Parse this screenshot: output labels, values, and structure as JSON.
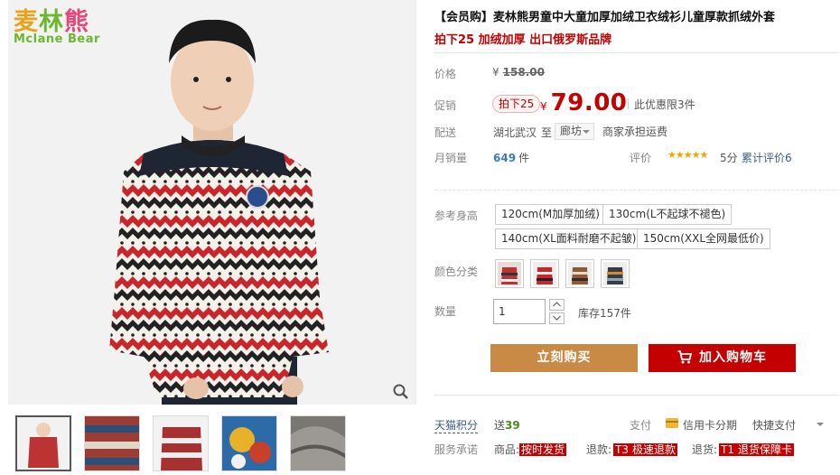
{
  "brand": {
    "name_cn": "麦林熊",
    "name_en": "Mclane Bear"
  },
  "product": {
    "title": "【会员购】麦林熊男童中大童加厚加绒卫衣绒衫儿童厚款抓绒外套",
    "subtitle": "拍下25 加绒加厚 出口俄罗斯品牌"
  },
  "price": {
    "label": "价格",
    "original": "158.00",
    "currency": "¥"
  },
  "promo": {
    "label": "促销",
    "tag": "拍下25",
    "currency": "¥",
    "price": "79.00",
    "limit": "此优惠限3件"
  },
  "delivery": {
    "label": "配送",
    "from": "湖北武汉",
    "to_word": "至",
    "to_city": "廊坊",
    "note": "商家承担运费"
  },
  "sales": {
    "label": "月销量",
    "count": "649",
    "unit": "件",
    "rating_label": "评价",
    "stars": "★★★★★",
    "score": "5分",
    "review_link": "累计评价6",
    "rating_value": 5
  },
  "sizes": {
    "label": "参考身高",
    "options": [
      "120cm(M加厚加绒)",
      "130cm(L不起球不褪色)",
      "140cm(XL面料耐磨不起皱)",
      "150cm(XXL全网最低价)"
    ]
  },
  "colors": {
    "label": "颜色分类",
    "swatches": [
      "red-stripe",
      "red-zigzag",
      "brown-stripe",
      "dark-pattern"
    ]
  },
  "quantity": {
    "label": "数量",
    "value": "1",
    "stock": "库存157件"
  },
  "actions": {
    "buy": "立刻购买",
    "cart": "加入购物车"
  },
  "points": {
    "label": "天猫积分",
    "prefix": "送",
    "value": "39"
  },
  "payment": {
    "label": "支付",
    "card": "信用卡分期",
    "quick": "快捷支付"
  },
  "service": {
    "label": "服务承诺",
    "items": [
      {
        "prefix": "商品:",
        "code": "",
        "text": "按时发货"
      },
      {
        "prefix": "退款:",
        "code": "T3",
        "text": "极速退款"
      },
      {
        "prefix": "退货:",
        "code": "T1",
        "text": "退货保障卡"
      }
    ]
  },
  "colors_theme": {
    "accent_red": "#c40000",
    "buy_orange": "#c98a45",
    "link_blue": "#3c5c8c",
    "star_yellow": "#f4a400"
  }
}
